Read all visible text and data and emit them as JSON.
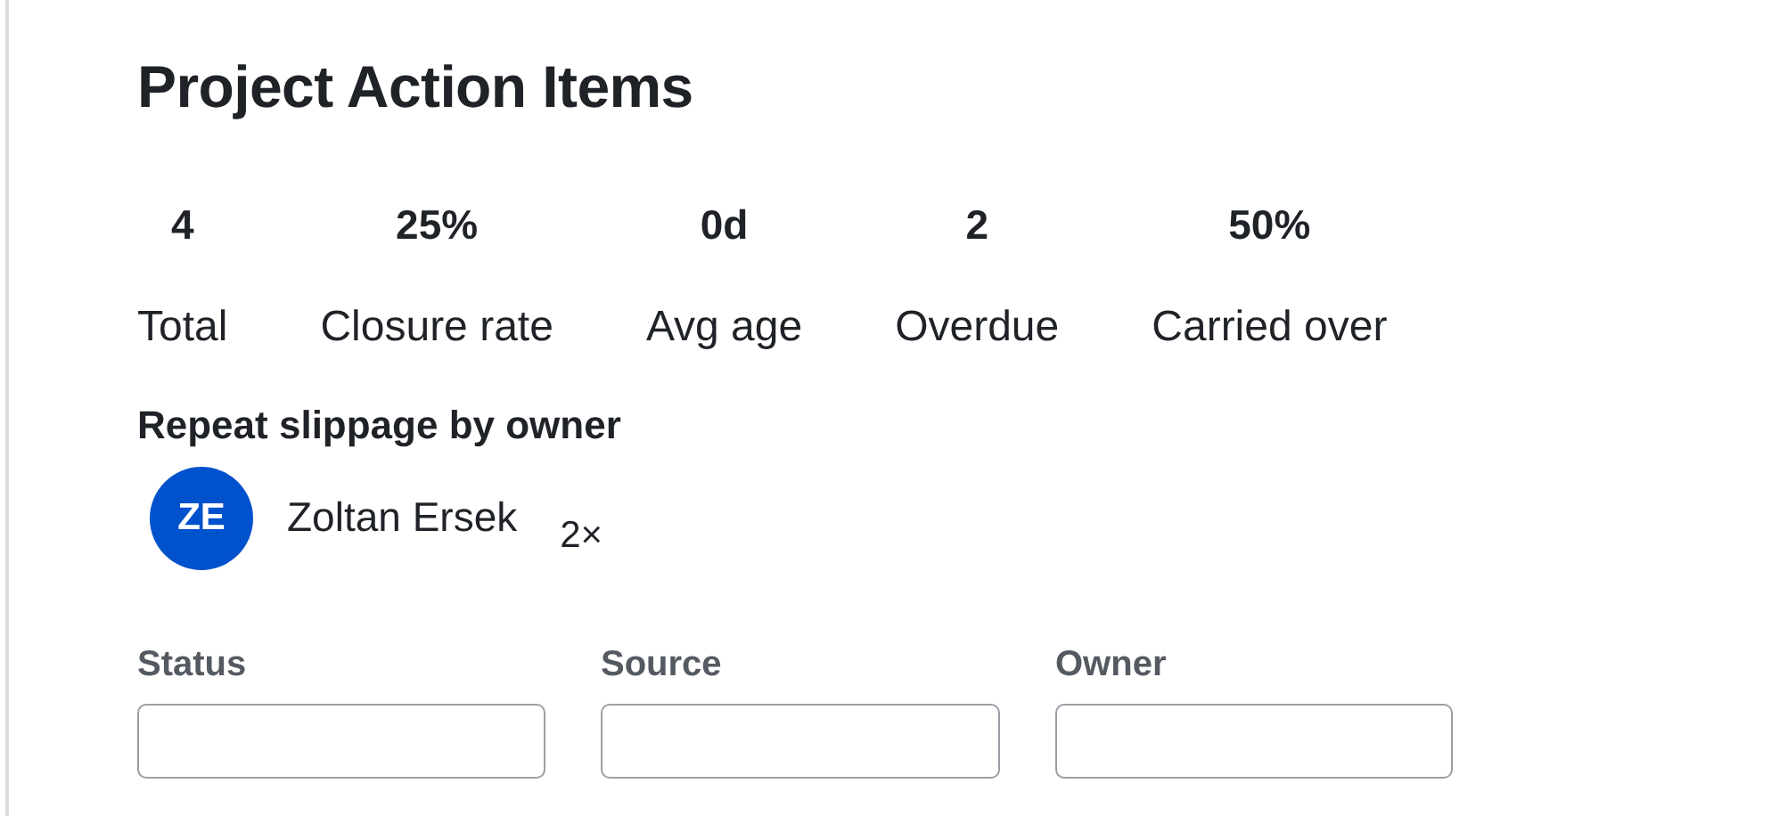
{
  "title": "Project Action Items",
  "stats": [
    {
      "value": "4",
      "label": "Total"
    },
    {
      "value": "25%",
      "label": "Closure rate"
    },
    {
      "value": "0d",
      "label": "Avg age"
    },
    {
      "value": "2",
      "label": "Overdue"
    },
    {
      "value": "50%",
      "label": "Carried over"
    }
  ],
  "slippage": {
    "heading": "Repeat slippage by owner",
    "owners": [
      {
        "initials": "ZE",
        "name": "Zoltan Ersek",
        "count": "2×",
        "color": "#0052cc"
      }
    ]
  },
  "filters": [
    {
      "label": "Status"
    },
    {
      "label": "Source"
    },
    {
      "label": "Owner"
    }
  ]
}
